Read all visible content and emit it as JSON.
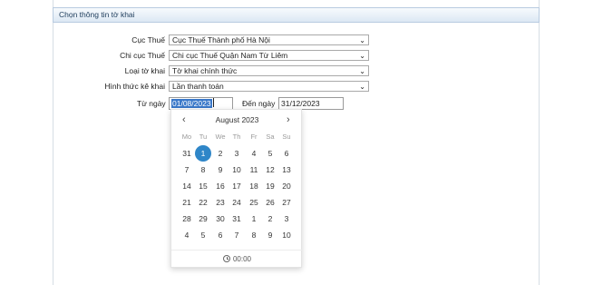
{
  "panel": {
    "title": "Chọn thông tin tờ khai"
  },
  "form": {
    "cuc_thue": {
      "label": "Cục Thuế",
      "value": "Cục Thuế Thành phố Hà Nội"
    },
    "chi_cuc_thue": {
      "label": "Chi cục Thuế",
      "value": "Chi cục Thuế Quận Nam Từ Liêm"
    },
    "loai_to_khai": {
      "label": "Loại tờ khai",
      "value": "Tờ khai chính thức"
    },
    "hinh_thuc_ke_khai": {
      "label": "Hình thức kê khai",
      "value": "Lần thanh toán"
    },
    "tu_ngay": {
      "label": "Từ ngày",
      "value": "01/08/2023"
    },
    "den_ngay": {
      "label": "Đến ngày",
      "value": "31/12/2023"
    }
  },
  "calendar": {
    "month_title": "August 2023",
    "prev": "‹",
    "next": "›",
    "weekdays": [
      "Mo",
      "Tu",
      "We",
      "Th",
      "Fr",
      "Sa",
      "Su"
    ],
    "weeks": [
      [
        "31",
        "1",
        "2",
        "3",
        "4",
        "5",
        "6"
      ],
      [
        "7",
        "8",
        "9",
        "10",
        "11",
        "12",
        "13"
      ],
      [
        "14",
        "15",
        "16",
        "17",
        "18",
        "19",
        "20"
      ],
      [
        "21",
        "22",
        "23",
        "24",
        "25",
        "26",
        "27"
      ],
      [
        "28",
        "29",
        "30",
        "31",
        "1",
        "2",
        "3"
      ],
      [
        "4",
        "5",
        "6",
        "7",
        "8",
        "9",
        "10"
      ]
    ],
    "selected_day": "1",
    "time": "00:00"
  },
  "colors": {
    "accent": "#2f86c8",
    "header_text": "#23415f"
  }
}
